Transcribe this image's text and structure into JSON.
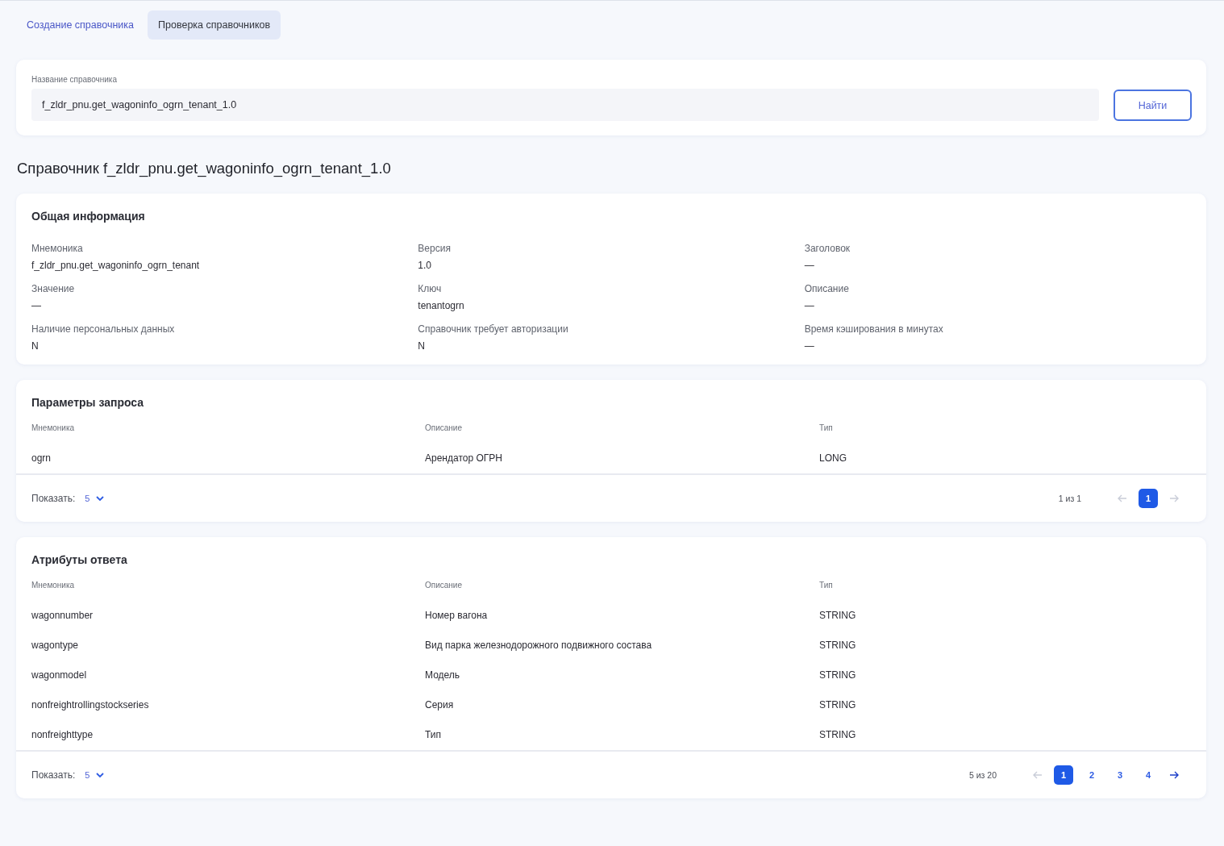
{
  "tabs": [
    {
      "label": "Создание справочника",
      "selected": false
    },
    {
      "label": "Проверка справочников",
      "selected": true
    }
  ],
  "search": {
    "label": "Название справочника",
    "value": "f_zldr_pnu.get_wagoninfo_ogrn_tenant_1.0",
    "button": "Найти"
  },
  "title": "Справочник f_zldr_pnu.get_wagoninfo_ogrn_tenant_1.0",
  "general": {
    "title": "Общая информация",
    "fields": [
      {
        "label": "Мнемоника",
        "value": "f_zldr_pnu.get_wagoninfo_ogrn_tenant"
      },
      {
        "label": "Версия",
        "value": "1.0"
      },
      {
        "label": "Заголовок",
        "value": "—"
      },
      {
        "label": "Значение",
        "value": "—"
      },
      {
        "label": "Ключ",
        "value": "tenantogrn"
      },
      {
        "label": "Описание",
        "value": "—"
      },
      {
        "label": "Наличие персональных данных",
        "value": "N"
      },
      {
        "label": "Справочник требует авторизации",
        "value": "N"
      },
      {
        "label": "Время кэширования в минутах",
        "value": "—"
      }
    ]
  },
  "tables": [
    {
      "title": "Параметры запроса",
      "columns": [
        "Мнемоника",
        "Описание",
        "Тип"
      ],
      "rows": [
        [
          "ogrn",
          "Арендатор ОГРН",
          "LONG"
        ]
      ],
      "footer": {
        "show_label": "Показать:",
        "page_size": "5",
        "range": "1 из 1",
        "prev_disabled": true,
        "next_disabled": true,
        "pages": [
          {
            "label": "1",
            "selected": true
          }
        ]
      }
    },
    {
      "title": "Атрибуты ответа",
      "columns": [
        "Мнемоника",
        "Описание",
        "Тип"
      ],
      "rows": [
        [
          "wagonnumber",
          "Номер вагона",
          "STRING"
        ],
        [
          "wagontype",
          "Вид парка железнодорожного подвижного состава",
          "STRING"
        ],
        [
          "wagonmodel",
          "Модель",
          "STRING"
        ],
        [
          "nonfreightrollingstockseries",
          "Серия",
          "STRING"
        ],
        [
          "nonfreighttype",
          "Тип",
          "STRING"
        ]
      ],
      "footer": {
        "show_label": "Показать:",
        "page_size": "5",
        "range": "5 из 20",
        "prev_disabled": true,
        "next_disabled": false,
        "pages": [
          {
            "label": "1",
            "selected": true
          },
          {
            "label": "2",
            "selected": false
          },
          {
            "label": "3",
            "selected": false
          },
          {
            "label": "4",
            "selected": false
          }
        ]
      }
    }
  ]
}
